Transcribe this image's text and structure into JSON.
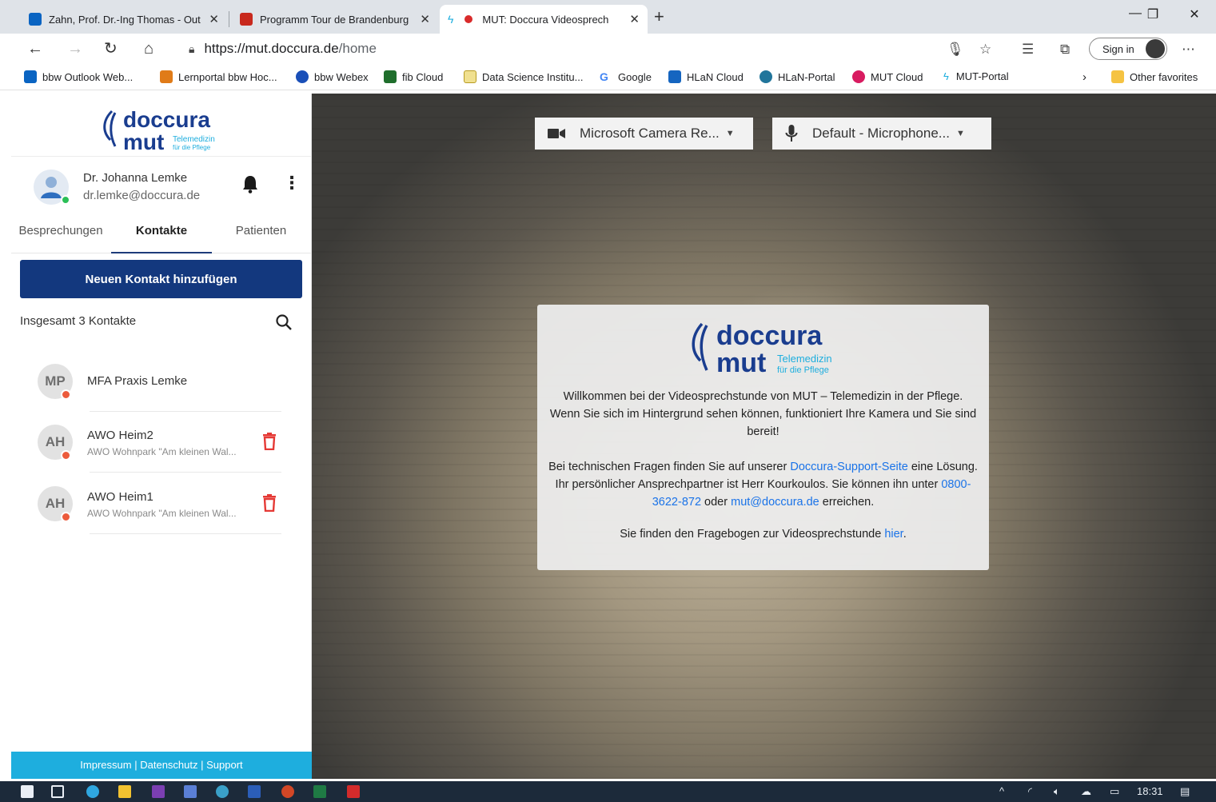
{
  "browser": {
    "tabs": [
      {
        "title": "Zahn, Prof. Dr.-Ing Thomas - Out",
        "icon": "outlook-icon"
      },
      {
        "title": "Programm Tour de Brandenburg",
        "icon": "pdf-icon"
      },
      {
        "title": "MUT: Doccura Videosprech",
        "icon": "doccura-icon",
        "recording": true,
        "active": true
      }
    ],
    "url_host": "https://mut.doccura.de",
    "url_path": "/home",
    "sign_in_label": "Sign in",
    "favorites": [
      "bbw Outlook Web...",
      "Lernportal bbw Hoc...",
      "bbw Webex",
      "fib Cloud",
      "Data Science Institu...",
      "Google",
      "HLaN Cloud",
      "HLaN-Portal",
      "MUT Cloud",
      "MUT-Portal"
    ],
    "other_favorites": "Other favorites"
  },
  "sidebar": {
    "logo_top": "doccura",
    "logo_bottom": "mut",
    "logo_tag1": "Telemedizin",
    "logo_tag2": "für die Pflege",
    "user_name": "Dr. Johanna Lemke",
    "user_email": "dr.lemke@doccura.de",
    "tabs": [
      "Besprechungen",
      "Kontakte",
      "Patienten"
    ],
    "active_tab": "Kontakte",
    "add_contact_label": "Neuen Kontakt hinzufügen",
    "contact_count": "Insgesamt 3 Kontakte",
    "contacts": [
      {
        "initials": "MP",
        "name": "MFA Praxis Lemke",
        "sub": ""
      },
      {
        "initials": "AH",
        "name": "AWO Heim2",
        "sub": "AWO Wohnpark \"Am kleinen Wal..."
      },
      {
        "initials": "AH",
        "name": "AWO Heim1",
        "sub": "AWO Wohnpark \"Am kleinen Wal..."
      }
    ],
    "footer": {
      "impressum": "Impressum",
      "datenschutz": "Datenschutz",
      "support": "Support",
      "sep": "|"
    }
  },
  "stage": {
    "camera_label": "Microsoft Camera Re...",
    "microphone_label": "Default - Microphone...",
    "info": {
      "line1": "Willkommen bei der Videosprechstunde von MUT – Telemedizin in der Pflege. Wenn Sie sich im Hintergrund sehen können, funktioniert Ihre Kamera und Sie sind bereit!",
      "line2_a": "Bei technischen Fragen finden Sie auf unserer ",
      "line2_link": "Doccura-Support-Seite",
      "line2_b": " eine Lösung. Ihr persönlicher Ansprechpartner ist Herr Kourkoulos. Sie können ihn unter ",
      "phone": "0800-3622-872",
      "line2_c": " oder ",
      "email": "mut@doccura.de",
      "line2_d": " erreichen.",
      "line3_a": "Sie finden den Fragebogen zur Videosprechstunde ",
      "line3_link": "hier",
      "line3_b": "."
    }
  },
  "taskbar": {
    "time": "18:31"
  }
}
